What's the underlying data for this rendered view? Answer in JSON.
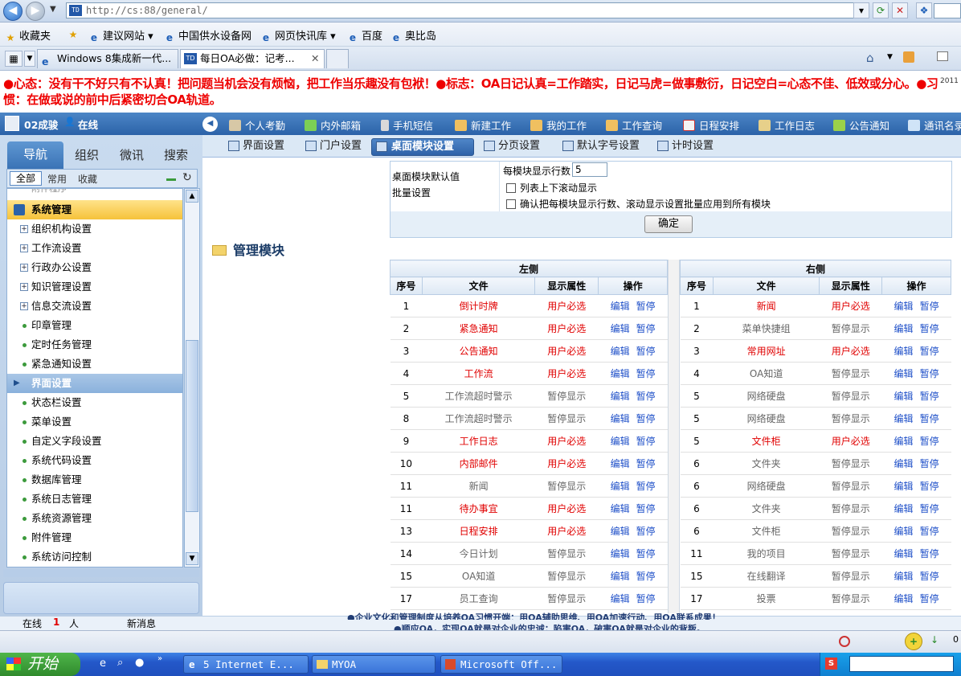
{
  "browser": {
    "url": "http://cs:88/general/",
    "favorites_label": "收藏夹",
    "favorites": [
      "建议网站",
      "中国供水设备网",
      "网页快讯库",
      "百度",
      "奥比岛"
    ],
    "tabs": [
      "Windows 8集成新一代...",
      "每日OA必做：记考..."
    ]
  },
  "banner": {
    "text": "●心态：没有干不好只有不认真！把问题当机会没有烦恼，把工作当乐趣没有包袱！●标志：OA日记认真=工作踏实，日记马虎=做事敷衍，日记空白=心态不佳、低效或分心。●习惯：在做或说的前中后紧密切合OA轨道。",
    "year": "2011"
  },
  "header": {
    "user": "02成骏",
    "status": "在线",
    "menu": [
      "个人考勤",
      "内外邮箱",
      "手机短信",
      "新建工作",
      "我的工作",
      "工作查询",
      "日程安排",
      "工作日志",
      "公告通知",
      "通讯名录"
    ]
  },
  "left": {
    "tabs": [
      "导航",
      "组织",
      "微讯",
      "搜索"
    ],
    "subtabs": [
      "全部",
      "常用",
      "收藏"
    ],
    "tree_partial": "附件程序",
    "tree": [
      {
        "label": "系统管理",
        "kind": "section",
        "active": true
      },
      {
        "label": "组织机构设置",
        "kind": "folder"
      },
      {
        "label": "工作流设置",
        "kind": "folder"
      },
      {
        "label": "行政办公设置",
        "kind": "folder"
      },
      {
        "label": "知识管理设置",
        "kind": "folder"
      },
      {
        "label": "信息交流设置",
        "kind": "folder"
      },
      {
        "label": "印章管理",
        "kind": "leaf"
      },
      {
        "label": "定时任务管理",
        "kind": "leaf"
      },
      {
        "label": "紧急通知设置",
        "kind": "leaf"
      },
      {
        "label": "界面设置",
        "kind": "section",
        "active": false
      },
      {
        "label": "状态栏设置",
        "kind": "leaf"
      },
      {
        "label": "菜单设置",
        "kind": "leaf"
      },
      {
        "label": "自定义字段设置",
        "kind": "leaf"
      },
      {
        "label": "系统代码设置",
        "kind": "leaf"
      },
      {
        "label": "数据库管理",
        "kind": "leaf"
      },
      {
        "label": "系统日志管理",
        "kind": "leaf"
      },
      {
        "label": "系统资源管理",
        "kind": "leaf"
      },
      {
        "label": "附件管理",
        "kind": "leaf"
      },
      {
        "label": "系统访问控制",
        "kind": "leaf"
      }
    ]
  },
  "subnav": [
    "界面设置",
    "门户设置",
    "桌面模块设置",
    "分页设置",
    "默认字号设置",
    "计时设置"
  ],
  "settings": {
    "label1": "桌面模块默认值",
    "label2": "批量设置",
    "rows_label": "每模块显示行数",
    "rows_value": "5",
    "check1": "列表上下滚动显示",
    "check2": "确认把每模块显示行数、滚动显示设置批量应用到所有模块",
    "ok": "确定"
  },
  "modules": {
    "title": "管理模块",
    "left_title": "左侧",
    "right_title": "右侧",
    "columns": [
      "序号",
      "文件",
      "显示属性",
      "操作"
    ],
    "edit": "编辑",
    "pause": "暂停",
    "left_rows": [
      {
        "no": "1",
        "name": "倒计时牌",
        "attr": "用户必选",
        "req": true
      },
      {
        "no": "2",
        "name": "紧急通知",
        "attr": "用户必选",
        "req": true
      },
      {
        "no": "3",
        "name": "公告通知",
        "attr": "用户必选",
        "req": true
      },
      {
        "no": "4",
        "name": "工作流",
        "attr": "用户必选",
        "req": true
      },
      {
        "no": "5",
        "name": "工作流超时警示",
        "attr": "暂停显示",
        "req": false
      },
      {
        "no": "8",
        "name": "工作流超时警示",
        "attr": "暂停显示",
        "req": false
      },
      {
        "no": "9",
        "name": "工作日志",
        "attr": "用户必选",
        "req": true
      },
      {
        "no": "10",
        "name": "内部邮件",
        "attr": "用户必选",
        "req": true
      },
      {
        "no": "11",
        "name": "新闻",
        "attr": "暂停显示",
        "req": false
      },
      {
        "no": "11",
        "name": "待办事宜",
        "attr": "用户必选",
        "req": true
      },
      {
        "no": "13",
        "name": "日程安排",
        "attr": "用户必选",
        "req": true
      },
      {
        "no": "14",
        "name": "今日计划",
        "attr": "暂停显示",
        "req": false
      },
      {
        "no": "15",
        "name": "OA知道",
        "attr": "暂停显示",
        "req": false
      },
      {
        "no": "17",
        "name": "员工查询",
        "attr": "暂停显示",
        "req": false
      }
    ],
    "right_rows": [
      {
        "no": "1",
        "name": "新闻",
        "attr": "用户必选",
        "req": true
      },
      {
        "no": "2",
        "name": "菜单快捷组",
        "attr": "暂停显示",
        "req": false
      },
      {
        "no": "3",
        "name": "常用网址",
        "attr": "用户必选",
        "req": true
      },
      {
        "no": "4",
        "name": "OA知道",
        "attr": "暂停显示",
        "req": false
      },
      {
        "no": "5",
        "name": "网络硬盘",
        "attr": "暂停显示",
        "req": false
      },
      {
        "no": "5",
        "name": "网络硬盘",
        "attr": "暂停显示",
        "req": false
      },
      {
        "no": "5",
        "name": "文件柜",
        "attr": "用户必选",
        "req": true
      },
      {
        "no": "6",
        "name": "文件夹",
        "attr": "暂停显示",
        "req": false
      },
      {
        "no": "6",
        "name": "网络硬盘",
        "attr": "暂停显示",
        "req": false
      },
      {
        "no": "6",
        "name": "文件夹",
        "attr": "暂停显示",
        "req": false
      },
      {
        "no": "6",
        "name": "文件柜",
        "attr": "暂停显示",
        "req": false
      },
      {
        "no": "11",
        "name": "我的项目",
        "attr": "暂停显示",
        "req": false
      },
      {
        "no": "15",
        "name": "在线翻译",
        "attr": "暂停显示",
        "req": false
      },
      {
        "no": "17",
        "name": "投票",
        "attr": "暂停显示",
        "req": false
      }
    ]
  },
  "footer": {
    "online_label": "在线",
    "online_count": "1",
    "online_unit": "人",
    "new_msg": "新消息",
    "scroll_text1": "●企业文化和管理制度从培养OA习惯开端：用OA辅助思维、用OA加速行动、用OA联系成果！",
    "scroll_text2": "●顺应OA，实现OA就是对企业的忠诚；陷害OA，破害OA就是对企业的背叛。"
  },
  "taskbar": {
    "start": "开始",
    "items": [
      "5 Internet E...",
      "MYOA",
      "Microsoft Off..."
    ]
  },
  "colors": {
    "accent": "#2b62a8",
    "required": "#e00000",
    "link": "#1e4fc8"
  }
}
